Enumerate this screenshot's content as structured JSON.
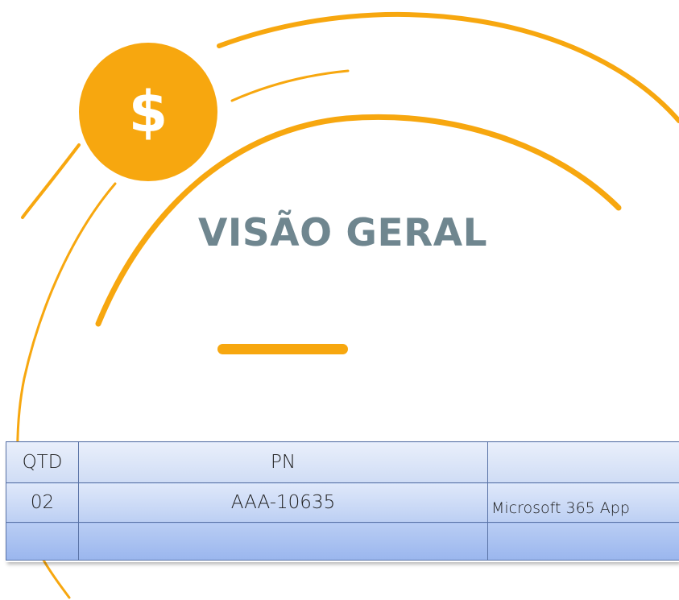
{
  "decor": {
    "coin_symbol": "$",
    "coin_color": "#f7a70f",
    "accent_color": "#f7a70f",
    "title_color": "#6f868f"
  },
  "title": "VISÃO GERAL",
  "table": {
    "headers": {
      "qtd": "QTD",
      "pn": "PN",
      "desc": ""
    },
    "row": {
      "qtd": "02",
      "pn": "AAA-10635",
      "desc": "Microsoft 365 App"
    },
    "empty_row": {
      "qtd": "",
      "pn": "",
      "desc": ""
    }
  }
}
